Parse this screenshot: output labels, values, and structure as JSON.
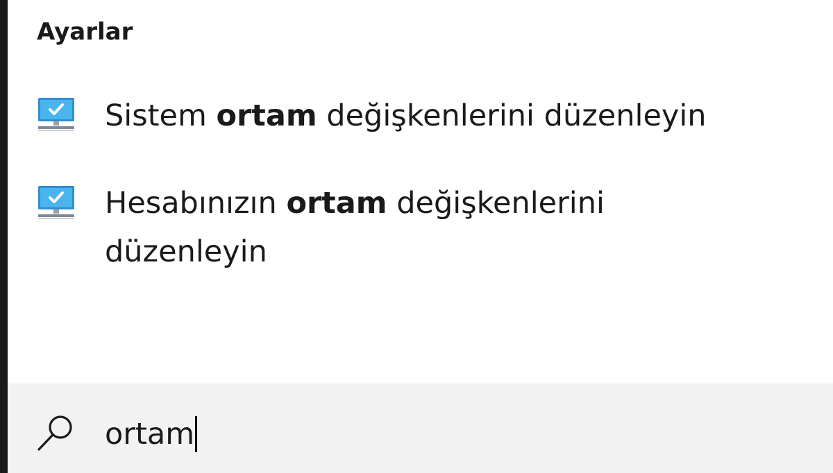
{
  "section": {
    "header": "Ayarlar"
  },
  "results": [
    {
      "icon": "monitor-icon",
      "prefix": "Sistem ",
      "highlight": "ortam",
      "suffix": " değişkenlerini düzenleyin"
    },
    {
      "icon": "monitor-icon",
      "prefix": "Hesabınızın ",
      "highlight": "ortam",
      "suffix": " değişkenlerini düzenleyin"
    }
  ],
  "search": {
    "icon": "search-icon",
    "query": "ortam"
  },
  "colors": {
    "edge": "#1b1b1b",
    "panel_bg": "#ffffff",
    "search_bg": "#f2f2f2",
    "monitor_screen": "#38a8e8",
    "monitor_check": "#ffffff"
  }
}
